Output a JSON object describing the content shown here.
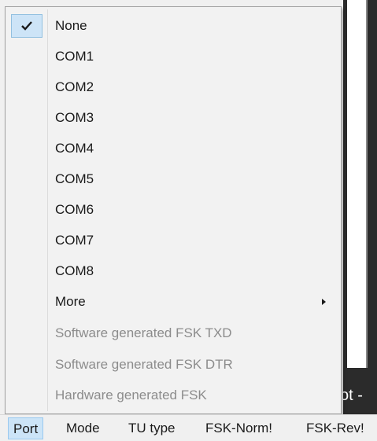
{
  "background": {
    "partial_text": "ot -"
  },
  "menu": {
    "items": [
      {
        "label": "None",
        "checked": true,
        "enabled": true
      },
      {
        "label": "COM1",
        "enabled": true
      },
      {
        "label": "COM2",
        "enabled": true
      },
      {
        "label": "COM3",
        "enabled": true
      },
      {
        "label": "COM4",
        "enabled": true
      },
      {
        "label": "COM5",
        "enabled": true
      },
      {
        "label": "COM6",
        "enabled": true
      },
      {
        "label": "COM7",
        "enabled": true
      },
      {
        "label": "COM8",
        "enabled": true
      },
      {
        "label": "More",
        "submenu": true,
        "enabled": true
      },
      {
        "label": "Software generated FSK TXD",
        "enabled": false
      },
      {
        "label": "Software generated FSK DTR",
        "enabled": false
      },
      {
        "label": "Hardware generated FSK",
        "enabled": false
      }
    ],
    "check_icon": "checkmark-icon",
    "submenu_icon": "submenu-arrow-icon"
  },
  "menubar": {
    "items": [
      {
        "label": "Port",
        "active": true
      },
      {
        "label": "Mode"
      },
      {
        "label": "TU type"
      },
      {
        "label": "FSK-Norm!"
      },
      {
        "label": "FSK-Rev!"
      }
    ]
  },
  "colors": {
    "highlight": "#cde4f7",
    "disabled_text": "#8c8c8c",
    "app_background": "#2b2b2b"
  }
}
